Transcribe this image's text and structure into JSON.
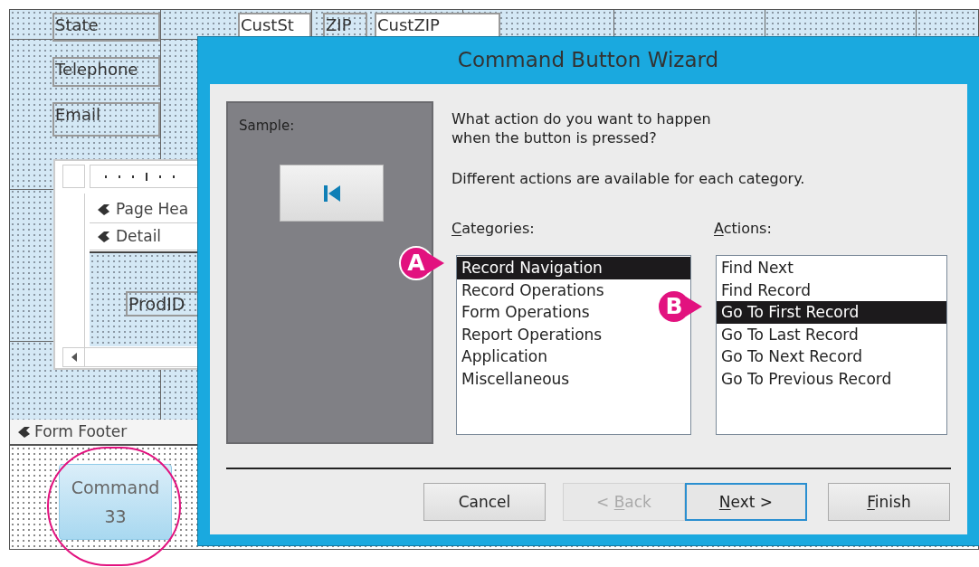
{
  "form_design": {
    "controls": [
      {
        "kind": "label",
        "text": "State"
      },
      {
        "kind": "textbox",
        "text": "CustSt"
      },
      {
        "kind": "label",
        "text": "ZIP"
      },
      {
        "kind": "textbox",
        "text": "CustZIP"
      },
      {
        "kind": "label",
        "text": "Telephone"
      },
      {
        "kind": "label",
        "text": "Email"
      }
    ],
    "subform": {
      "sections": [
        {
          "label": "Page Hea"
        },
        {
          "label": "Detail"
        }
      ],
      "controls": [
        {
          "text": "ProdID"
        }
      ]
    },
    "footer": {
      "label": "Form Footer"
    },
    "command_button": {
      "lines": [
        "Command",
        "33"
      ],
      "circled": true
    }
  },
  "dialog": {
    "title": "Command Button Wizard",
    "sample": {
      "label": "Sample:"
    },
    "prompt": "What action do you want to happen when the button is pressed?",
    "note": "Different actions are available for each category.",
    "categories": {
      "label": {
        "key": "C",
        "after": "ategories:"
      },
      "callout": "A",
      "items": [
        {
          "text": "Record Navigation",
          "selected": true
        },
        {
          "text": "Record Operations",
          "selected": false
        },
        {
          "text": "Form Operations",
          "selected": false
        },
        {
          "text": "Report Operations",
          "selected": false
        },
        {
          "text": "Application",
          "selected": false
        },
        {
          "text": "Miscellaneous",
          "selected": false
        }
      ]
    },
    "actions": {
      "label": {
        "key": "A",
        "after": "ctions:"
      },
      "callout": "B",
      "items": [
        {
          "text": "Find Next",
          "selected": false
        },
        {
          "text": "Find Record",
          "selected": false
        },
        {
          "text": "Go To First Record",
          "selected": true
        },
        {
          "text": "Go To Last Record",
          "selected": false
        },
        {
          "text": "Go To Next Record",
          "selected": false
        },
        {
          "text": "Go To Previous Record",
          "selected": false
        }
      ]
    },
    "buttons": [
      {
        "label": {
          "before": "Cancel"
        },
        "disabled": false,
        "default": false
      },
      {
        "label": {
          "before": "< ",
          "key": "B",
          "after": "ack"
        },
        "disabled": true,
        "default": false
      },
      {
        "label": {
          "key": "N",
          "after": "ext >"
        },
        "disabled": false,
        "default": true
      },
      {
        "label": {
          "key": "F",
          "after": "inish"
        },
        "disabled": false,
        "default": false
      }
    ]
  }
}
